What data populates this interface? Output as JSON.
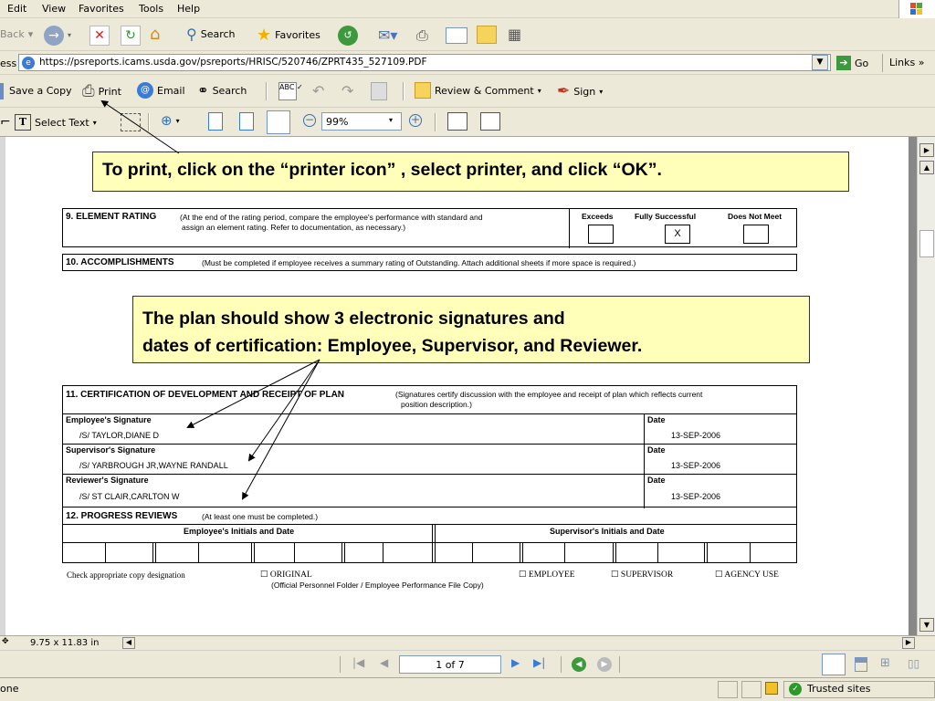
{
  "menu": {
    "edit": "Edit",
    "view": "View",
    "favorites": "Favorites",
    "tools": "Tools",
    "help": "Help"
  },
  "toolbar": {
    "back": "Back",
    "search": "Search",
    "favorites": "Favorites"
  },
  "address": {
    "label": "ess",
    "url": "https://psreports.icams.usda.gov/psreports/HRISC/520746/ZPRT435_527109.PDF",
    "go": "Go",
    "links": "Links »"
  },
  "pdf_toolbar": {
    "save_copy": "Save a Copy",
    "print": "Print",
    "email": "Email",
    "search": "Search",
    "review": "Review & Comment",
    "sign": "Sign"
  },
  "pdf_toolbar2": {
    "select_text": "Select Text",
    "zoom": "99%"
  },
  "callouts": {
    "print_tip": "To print, click on the “printer icon” , select printer, and click “OK”.",
    "sig_tip_line1": "The plan should show 3 electronic signatures and",
    "sig_tip_line2": "dates of certification: Employee, Supervisor, and Reviewer."
  },
  "form": {
    "s9_title": "9. ELEMENT RATING",
    "s9_desc1": "(At the end of the rating period, compare the employee's performance with standard and",
    "s9_desc2": "assign an element rating.  Refer to documentation, as necessary.)",
    "rating_exceeds": "Exceeds",
    "rating_fs": "Fully Successful",
    "rating_dnm": "Does Not Meet",
    "rating_mark": "X",
    "s10_title": "10. ACCOMPLISHMENTS",
    "s10_desc": "(Must be completed if employee receives a summary rating of Outstanding.  Attach additional sheets if more space is required.)",
    "s11_title": "11. CERTIFICATION OF DEVELOPMENT AND RECEIPT OF PLAN",
    "s11_desc1": "(Signatures certify discussion with the employee and receipt of plan which reflects current",
    "s11_desc2": "position description.)",
    "emp_sig_label": "Employee's Signature",
    "emp_sig": "/S/ TAYLOR,DIANE D",
    "sup_sig_label": "Supervisor's Signature",
    "sup_sig": "/S/ YARBROUGH JR,WAYNE RANDALL",
    "rev_sig_label": "Reviewer's Signature",
    "rev_sig": "/S/ ST CLAIR,CARLTON W",
    "date_label": "Date",
    "emp_date": "13-SEP-2006",
    "sup_date": "13-SEP-2006",
    "rev_date": "13-SEP-2006",
    "s12_title": "12. PROGRESS REVIEWS",
    "s12_desc": "(At least one must be completed.)",
    "emp_initials": "Employee's Initials and Date",
    "sup_initials": "Supervisor's Initials and Date",
    "copy_label": "Check appropriate copy designation",
    "copy_original": "ORIGINAL",
    "copy_original_sub": "(Official Personnel Folder / Employee Performance File Copy)",
    "copy_employee": "EMPLOYEE",
    "copy_supervisor": "SUPERVISOR",
    "copy_agency": "AGENCY USE"
  },
  "bottom": {
    "page_size": "9.75 x 11.83 in",
    "page_indicator": "1 of 7"
  },
  "status": {
    "left": "one",
    "zone": "Trusted sites"
  }
}
